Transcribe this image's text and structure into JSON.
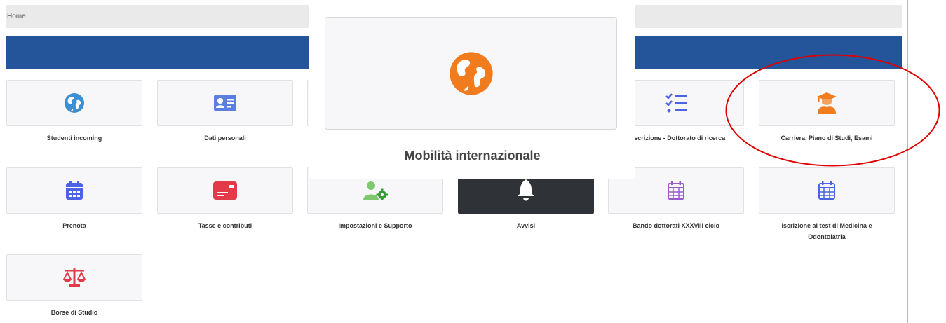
{
  "breadcrumb": {
    "home_label": "Home"
  },
  "tiles": {
    "studenti_incoming": {
      "label": "Studenti incoming",
      "icon": "globe-icon",
      "color": "#3b8fd6"
    },
    "dati_personali": {
      "label": "Dati personali",
      "icon": "id-card-icon",
      "color": "#5b7fe0"
    },
    "iscrizione_dottorato": {
      "label": "o iscrizione - Dottorato di ricerca",
      "icon": "checklist-icon",
      "color": "#4b63e4"
    },
    "carriera": {
      "label": "Carriera, Piano di Studi, Esami",
      "icon": "graduate-icon",
      "color": "#f07c1e"
    },
    "prenota": {
      "label": "Prenota",
      "icon": "calendar-icon",
      "color": "#4b63e4"
    },
    "tasse": {
      "label": "Tasse e contributi",
      "icon": "credit-card-icon",
      "color": "#e23a49"
    },
    "impostazioni": {
      "label": "Impostazioni e Supporto",
      "icon": "user-gear-icon",
      "color": "#58b84d"
    },
    "avvisi": {
      "label": "Avvisi",
      "icon": "bell-icon",
      "color": "#ffffff"
    },
    "bando_dottorati": {
      "label": "Bando dottorati XXXVIII ciclo",
      "icon": "calendar-grid-icon",
      "color": "#9b59d0"
    },
    "test_medicina": {
      "label": "Iscrizione al test di Medicina e Odontoiatria",
      "icon": "calendar-grid-icon",
      "color": "#4b63e4"
    },
    "borse_studio": {
      "label": "Borse di Studio",
      "icon": "balance-scale-icon",
      "color": "#e23a49"
    }
  },
  "popup": {
    "title": "Mobilità internazionale",
    "icon": "globe-icon",
    "color": "#f07c1e"
  },
  "annotation": {
    "shape": "ellipse",
    "color": "#e00000"
  }
}
